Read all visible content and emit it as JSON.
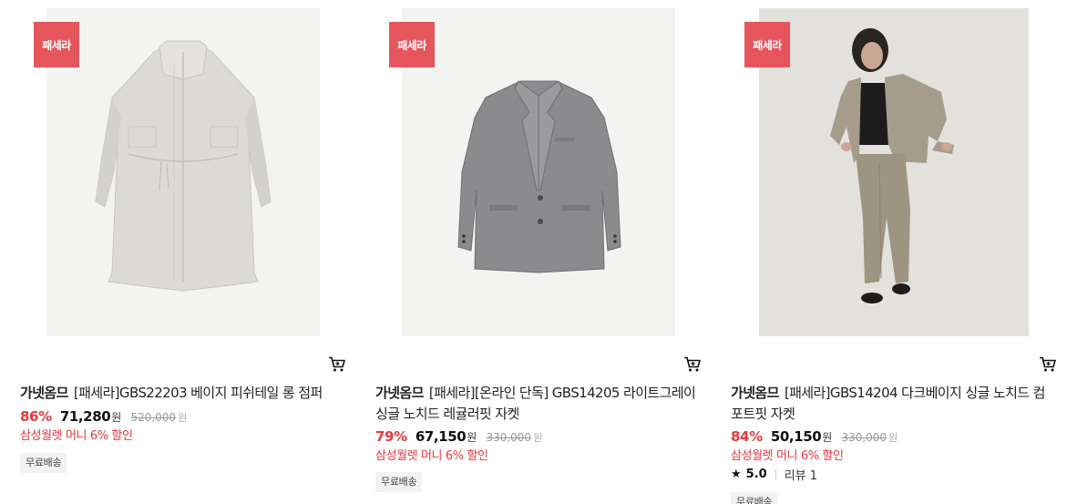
{
  "products": [
    {
      "badge": "패세라",
      "brand": "가넷옴므",
      "name": "[패세라]GBS22203 베이지 피쉬테일 롱 점퍼",
      "discount": "86%",
      "price": "71,280",
      "currency": "원",
      "original_price": "520,000",
      "promo": "삼성월렛 머니 6% 할인",
      "shipping": "무료배송",
      "image": "beige-fishtail-long-coat",
      "cart_icon": "cart-icon"
    },
    {
      "badge": "패세라",
      "brand": "가넷옴므",
      "name": "[패세라][온라인 단독] GBS14205 라이트그레이 싱글 노치드 레귤러핏 자켓",
      "discount": "79%",
      "price": "67,150",
      "currency": "원",
      "original_price": "330,000",
      "promo": "삼성월렛 머니 6% 할인",
      "shipping": "무료배송",
      "image": "light-gray-blazer",
      "cart_icon": "cart-icon"
    },
    {
      "badge": "패세라",
      "brand": "가넷옴므",
      "name": "[패세라]GBS14204 다크베이지 싱글 노치드 컴포트핏 자켓",
      "discount": "84%",
      "price": "50,150",
      "currency": "원",
      "original_price": "330,000",
      "promo": "삼성월렛 머니 6% 할인",
      "rating": "5.0",
      "review": "리뷰 1",
      "shipping": "무료배송",
      "image": "model-in-dark-beige-suit",
      "cart_icon": "cart-icon"
    }
  ],
  "colors": {
    "badge": "#e4555c",
    "discount": "#e5383f",
    "promo": "#e5383f"
  }
}
